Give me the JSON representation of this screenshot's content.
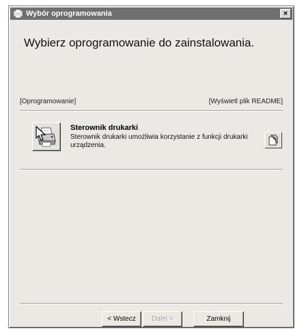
{
  "window": {
    "title": "Wybór oprogramowania",
    "close_glyph": "×"
  },
  "main": {
    "heading": "Wybierz oprogramowanie do zainstalowania."
  },
  "list": {
    "header_left": "[Oprogramowanie]",
    "header_right": "[Wyświetl plik README]",
    "items": [
      {
        "title": "Sterownik drukarki",
        "description": "Sterownik drukarki umożliwia korzystanie z funkcji drukarki urządzenia.",
        "icon": "printer-icon",
        "readme_icon": "document-icon"
      }
    ]
  },
  "footer": {
    "back_label": "< Wstecz",
    "next_label": "Dalej >",
    "close_label": "Zamknij"
  }
}
